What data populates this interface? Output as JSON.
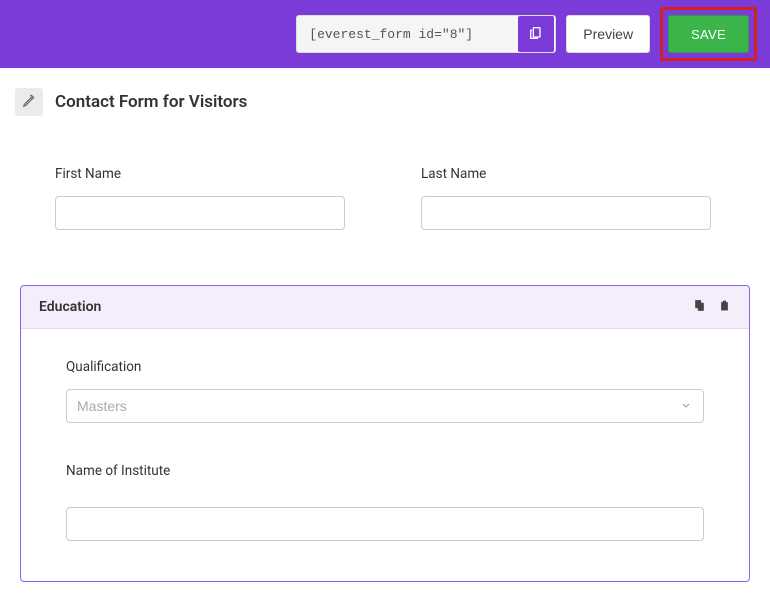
{
  "toolbar": {
    "shortcode_value": "[everest_form id=\"8\"]",
    "preview_label": "Preview",
    "save_label": "SAVE"
  },
  "form": {
    "title": "Contact Form for Visitors",
    "first_name_label": "First Name",
    "last_name_label": "Last Name"
  },
  "section": {
    "title": "Education",
    "qualification_label": "Qualification",
    "qualification_selected": "Masters",
    "institute_label": "Name of Institute"
  }
}
